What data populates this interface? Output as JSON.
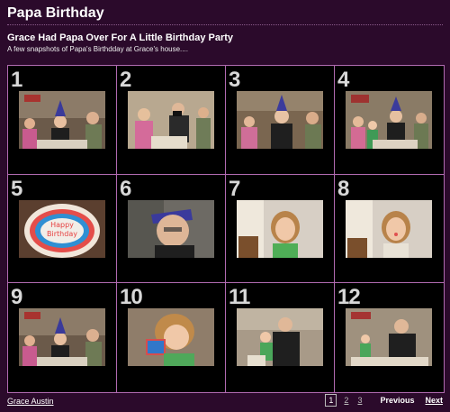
{
  "page": {
    "title": "Papa Birthday",
    "gallery_title": "Grace Had Papa Over For A Little Birthday Party",
    "gallery_description": "A few snapshots of Papa's Birthdday at Grace's house...."
  },
  "photos": [
    {
      "number": "1",
      "scene": "party-group"
    },
    {
      "number": "2",
      "scene": "party-camera"
    },
    {
      "number": "3",
      "scene": "party-group-close"
    },
    {
      "number": "4",
      "scene": "party-cake-table"
    },
    {
      "number": "5",
      "scene": "birthday-cake"
    },
    {
      "number": "6",
      "scene": "papa-laughing"
    },
    {
      "number": "7",
      "scene": "girl-smiling"
    },
    {
      "number": "8",
      "scene": "girl-tongue"
    },
    {
      "number": "9",
      "scene": "party-group"
    },
    {
      "number": "10",
      "scene": "girl-drinking"
    },
    {
      "number": "11",
      "scene": "papa-girl"
    },
    {
      "number": "12",
      "scene": "papa-girl-table"
    }
  ],
  "footer": {
    "author": "Grace Austin",
    "pages": [
      "1",
      "2",
      "3"
    ],
    "current_page": "1",
    "previous_label": "Previous",
    "next_label": "Next"
  },
  "colors": {
    "background": "#2b0a2b",
    "grid_border": "#b06ab0"
  }
}
